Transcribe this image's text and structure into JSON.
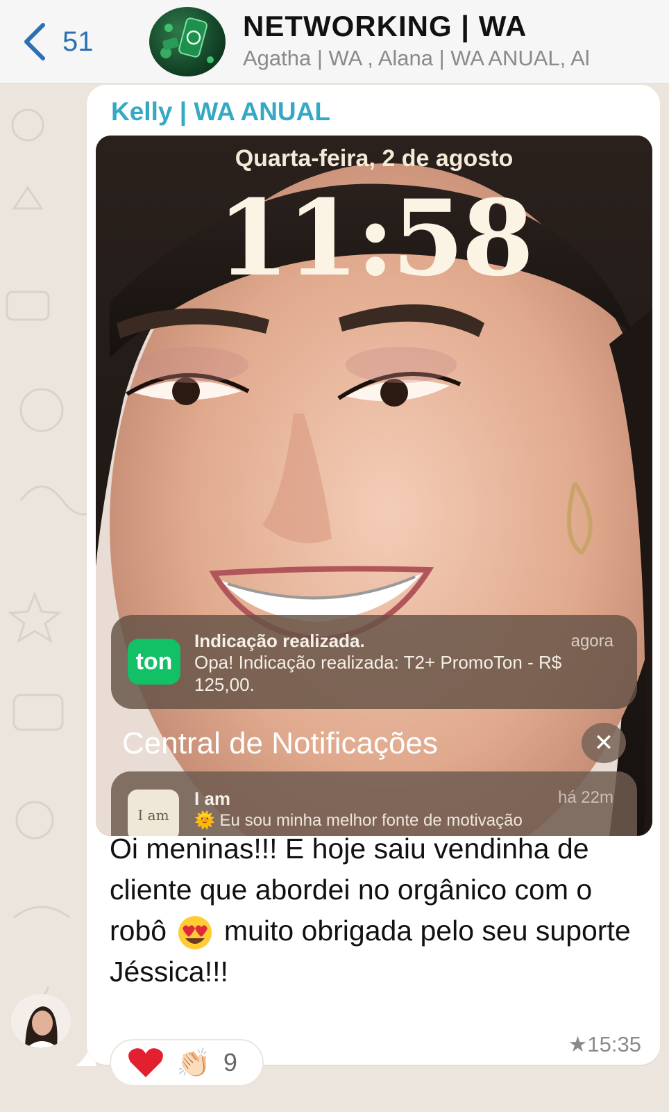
{
  "header": {
    "back_count": "51",
    "title": "NETWORKING | WA",
    "subtitle": "Agatha | WA , Alana | WA ANUAL, Al"
  },
  "message": {
    "sender": "Kelly | WA ANUAL",
    "image": {
      "lock_date": "Quarta-feira, 2 de agosto",
      "lock_time": "11:58",
      "notification": {
        "app_icon_text": "ton",
        "title": "Indicação realizada.",
        "time": "agora",
        "body": "Opa! Indicação realizada: T2+ PromoTon - R$ 125,00."
      },
      "central_title": "Central de Notificações",
      "close_symbol": "✕",
      "notification2": {
        "app_icon_text": "I am",
        "title": "I am",
        "time": "há 22m",
        "body": "🌞 Eu sou minha melhor fonte de motivação"
      }
    },
    "text_part1": "Oi meninas!!! E hoje saiu vendinha de cliente que abordei no orgânico com o robô",
    "text_part2": "muito obrigada pelo seu suporte Jéssica!!!",
    "time": "★15:35",
    "reactions": {
      "clap": "👏🏻",
      "count": "9"
    }
  },
  "colors": {
    "sender_name": "#35a9c4",
    "back_blue": "#2d6fb5",
    "chat_bg": "#ece5dd",
    "ton_green": "#12c066"
  },
  "icons": [
    "chevron-left-icon",
    "heart-icon",
    "clap-icon",
    "heart-eyes-icon",
    "close-icon"
  ]
}
